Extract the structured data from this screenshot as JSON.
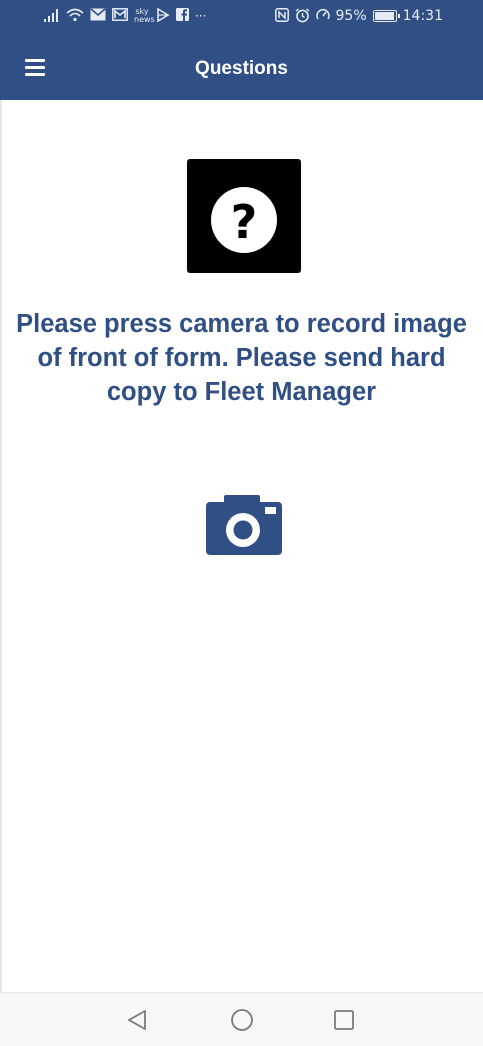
{
  "status_bar": {
    "sky_news": "sky news",
    "more_indicator": "···",
    "battery_percent": "95%",
    "battery_level": 0.95,
    "time": "14:31",
    "icons": [
      "signal-icon",
      "wifi-icon",
      "mail-icon",
      "gmail-icon",
      "sky-news-icon",
      "play-icon",
      "facebook-icon",
      "nfc-icon",
      "alarm-icon",
      "speed-icon",
      "battery-icon"
    ]
  },
  "app_bar": {
    "title": "Questions",
    "menu_icon": "hamburger-menu-icon",
    "background_color": "#2f4f85"
  },
  "main": {
    "question_icon": "question-mark-icon",
    "instruction": "Please press camera to record image of front of form. Please send hard copy to Fleet Manager",
    "camera_icon": "camera-icon",
    "accent_color": "#2f4f85"
  },
  "nav_bar": {
    "back_icon": "back-triangle-icon",
    "home_icon": "home-circle-icon",
    "recent_icon": "recent-apps-square-icon"
  }
}
